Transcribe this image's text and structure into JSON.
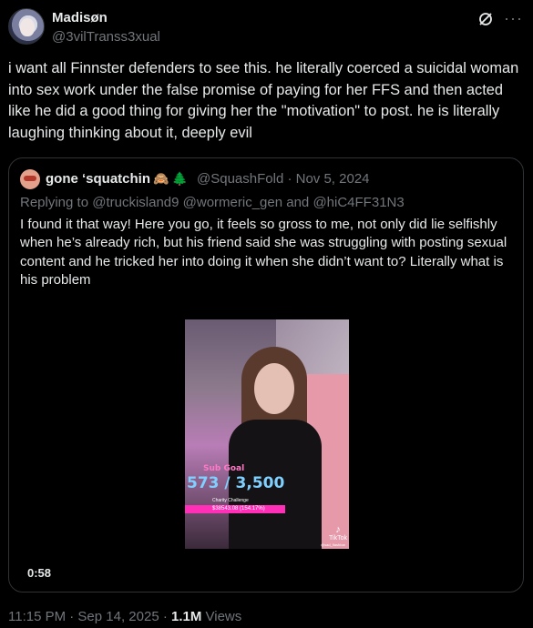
{
  "author": {
    "name": "Madisøn",
    "handle": "@3vilTranss3xual"
  },
  "tweet": {
    "text": "i want all Finnster defenders to see this. he literally coerced a suicidal woman into sex work under the false promise of paying for her FFS and then acted like he did a good thing for giving her the \"motivation\" to post. he is literally laughing thinking about it, deeply evil"
  },
  "icons": {
    "grok": "grok-icon",
    "more": "more-icon",
    "emoji1": "🙈",
    "emoji2": "🌲",
    "tiktok": "♪"
  },
  "quote": {
    "name": "gone ‘squatchin",
    "meta": "@SquashFold · Nov 5, 2024",
    "reply_prefix": "Replying to ",
    "reply_to": "@truckisland9 @wormeric_gen and @hiC4FF31N3",
    "text": "I found it that way! Here you go, it feels so gross to me, not only did lie selfishly when he’s already rich, but his friend said she was struggling with posting sexual content and he tricked her into doing it when she didn’t want to? Literally what is his problem",
    "video": {
      "sub_goal": "Sub Goal",
      "sub_count": "573 / 3,500",
      "charity_label": "Charity Challenge",
      "charity_value": "$38543.08 (154.17%)",
      "tiktok_label": "TikTok",
      "tiktok_handle": "@sad_flashbar",
      "duration": "0:58"
    }
  },
  "footer": {
    "time": "11:15 PM · Sep 14, 2025 · ",
    "views_count": "1.1M",
    "views_label": " Views"
  }
}
